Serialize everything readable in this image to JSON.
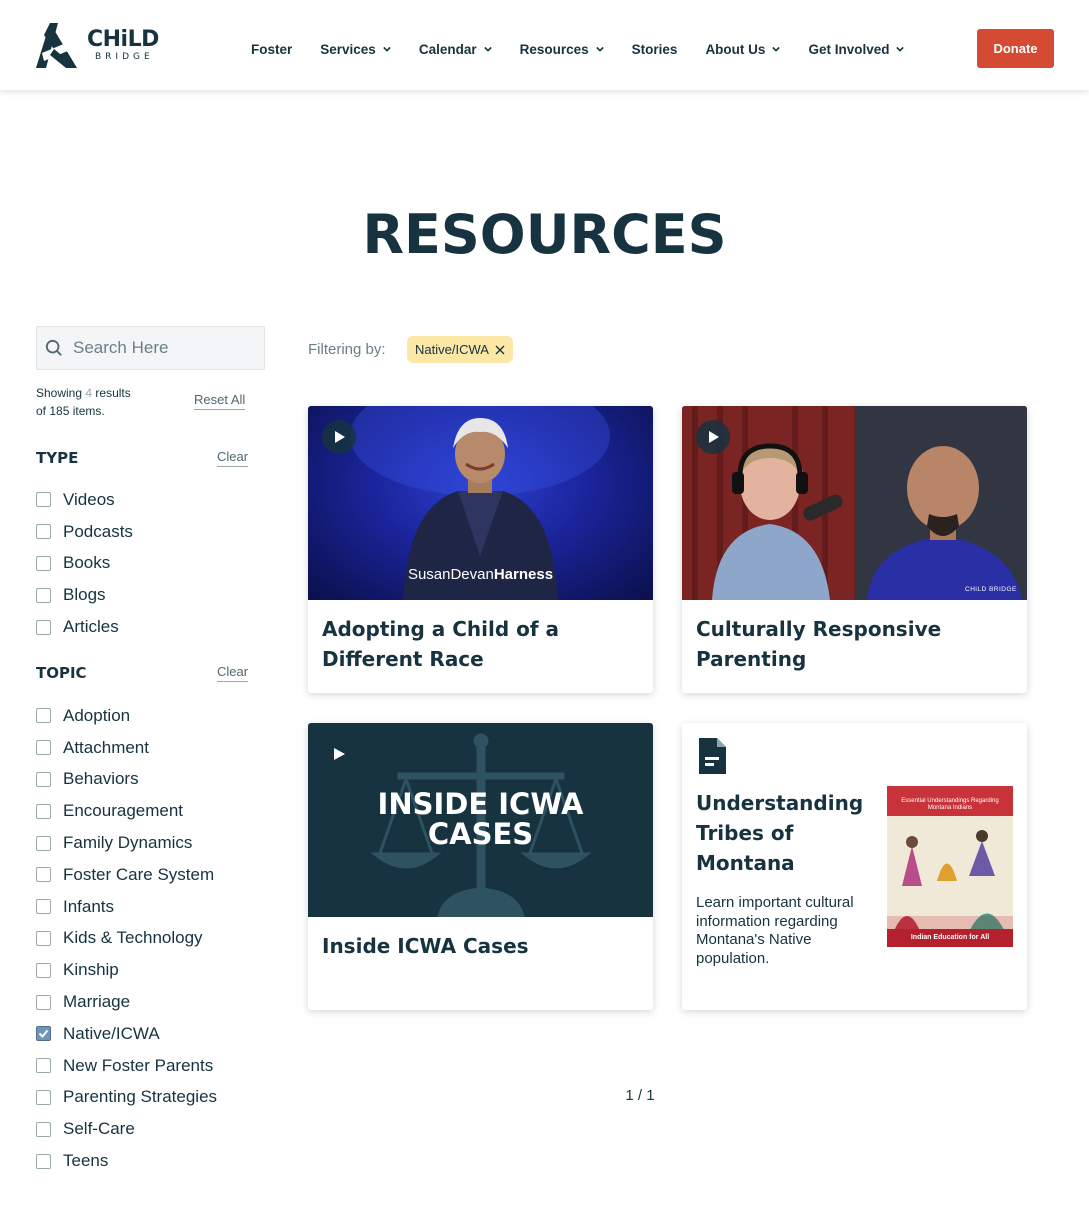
{
  "header": {
    "logo": {
      "main": "CHiLD",
      "sub": "BRIDGE"
    },
    "nav": [
      {
        "label": "Foster",
        "has_dropdown": false
      },
      {
        "label": "Services",
        "has_dropdown": true
      },
      {
        "label": "Calendar",
        "has_dropdown": true
      },
      {
        "label": "Resources",
        "has_dropdown": true
      },
      {
        "label": "Stories",
        "has_dropdown": false
      },
      {
        "label": "About Us",
        "has_dropdown": true
      },
      {
        "label": "Get Involved",
        "has_dropdown": true
      }
    ],
    "donate_label": "Donate"
  },
  "page_title": "RESOURCES",
  "sidebar": {
    "search_placeholder": "Search Here",
    "showing": {
      "prefix": "Showing",
      "count": "4",
      "suffix": "results",
      "line2": "of 185 items."
    },
    "reset_label": "Reset All",
    "type": {
      "heading": "TYPE",
      "clear_label": "Clear",
      "options": [
        {
          "label": "Videos",
          "checked": false
        },
        {
          "label": "Podcasts",
          "checked": false
        },
        {
          "label": "Books",
          "checked": false
        },
        {
          "label": "Blogs",
          "checked": false
        },
        {
          "label": "Articles",
          "checked": false
        }
      ]
    },
    "topic": {
      "heading": "TOPIC",
      "clear_label": "Clear",
      "options": [
        {
          "label": "Adoption",
          "checked": false
        },
        {
          "label": "Attachment",
          "checked": false
        },
        {
          "label": "Behaviors",
          "checked": false
        },
        {
          "label": "Encouragement",
          "checked": false
        },
        {
          "label": "Family Dynamics",
          "checked": false
        },
        {
          "label": "Foster Care System",
          "checked": false
        },
        {
          "label": "Infants",
          "checked": false
        },
        {
          "label": "Kids & Technology",
          "checked": false
        },
        {
          "label": "Kinship",
          "checked": false
        },
        {
          "label": "Marriage",
          "checked": false
        },
        {
          "label": "Native/ICWA",
          "checked": true
        },
        {
          "label": "New Foster Parents",
          "checked": false
        },
        {
          "label": "Parenting Strategies",
          "checked": false
        },
        {
          "label": "Self-Care",
          "checked": false
        },
        {
          "label": "Teens",
          "checked": false
        }
      ]
    }
  },
  "filter_bar": {
    "label": "Filtering by:",
    "chip": "Native/ICWA"
  },
  "cards": [
    {
      "title_line1": "Adopting a Child of a",
      "title_line2": "Different Race",
      "image_caption_a": "SusanDevan",
      "image_caption_b": "Harness",
      "type_icon": "play-icon"
    },
    {
      "title_line1": "Culturally Responsive",
      "title_line2": "Parenting",
      "image_watermark": "CHiLD BRIDGE",
      "type_icon": "play-icon"
    },
    {
      "title": "Inside ICWA Cases",
      "image_text_line1": "INSIDE ICWA",
      "image_text_line2": "CASES",
      "type_icon": "play-icon"
    },
    {
      "title_line1": "Understanding",
      "title_line2": "Tribes of",
      "title_line3": "Montana",
      "description": "Learn important cultural information regarding Montana's Native population.",
      "book_title": "Essential Understandings Regarding Montana Indians",
      "book_footer": "Indian Education for All",
      "type_icon": "document-icon"
    }
  ],
  "pagination": "1 / 1",
  "colors": {
    "primary": "#16333f",
    "donate": "#d44a33",
    "chip": "#fbe8a6",
    "checkbox_checked": "#6f94b5"
  }
}
